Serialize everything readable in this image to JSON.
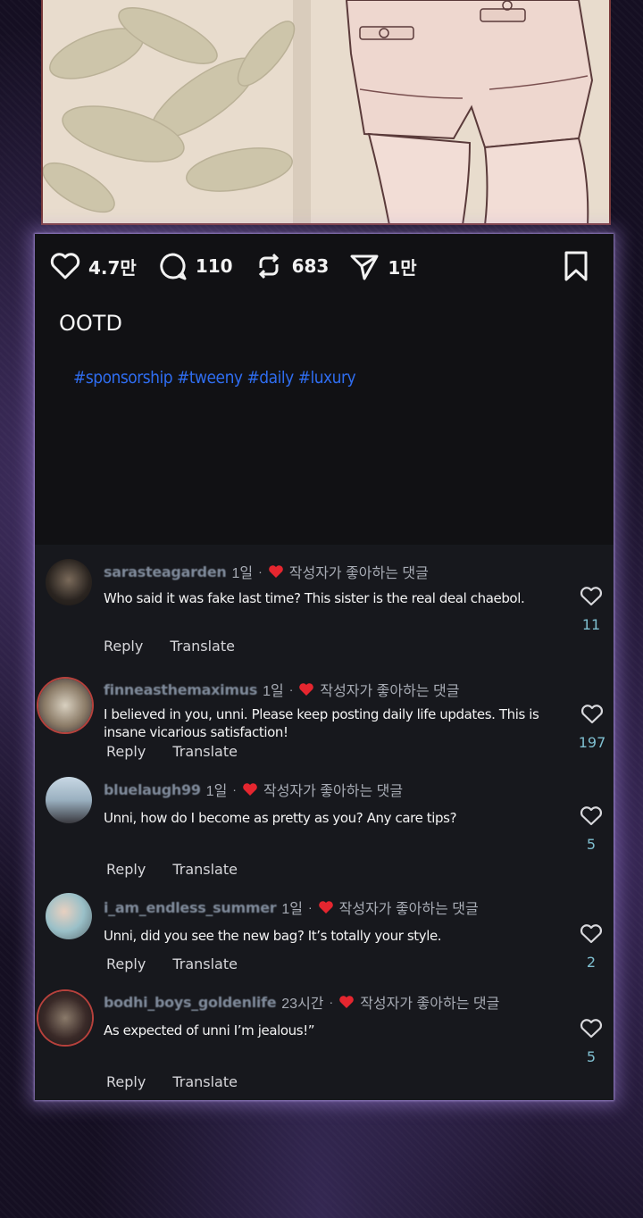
{
  "actions": {
    "likes": "4.7만",
    "comments": "110",
    "reposts": "683",
    "shares": "1만"
  },
  "post": {
    "caption": "OOTD",
    "hashtags": "#sponsorship #tweeny #daily #luxury"
  },
  "comment_labels": {
    "reply": "Reply",
    "translate": "Translate",
    "liked_by_author": "작성자가 좋아하는 댓글",
    "separator": "·"
  },
  "comments": [
    {
      "user": "sarasteagarden",
      "time": "1일",
      "text": "Who said it was fake last time? This sister is the real deal chaebol.",
      "likes": "11"
    },
    {
      "user": "finneasthemaximus",
      "time": "1일",
      "text": "I believed in you, unni. Please keep posting daily life updates. This is insane vicarious satisfaction!",
      "likes": "197"
    },
    {
      "user": "bluelaugh99",
      "time": "1일",
      "text": "Unni, how do I become as pretty as you? Any care tips?",
      "likes": "5"
    },
    {
      "user": "i_am_endless_summer",
      "time": "1일",
      "text": "Unni, did you see the new bag? It’s totally your style.",
      "likes": "2"
    },
    {
      "user": "bodhi_boys_goldenlife",
      "time": "23시간",
      "text": "As expected of unni  I’m jealous!”",
      "likes": "5"
    }
  ],
  "colors": {
    "panel_bg": "#111114",
    "comments_bg": "#17181d",
    "hashtag": "#2f6df0",
    "liked_heart": "#e5262f",
    "glow": "#b39ae8"
  },
  "icons": [
    "heart-outline-icon",
    "comment-bubble-icon",
    "repost-icon",
    "send-icon",
    "bookmark-icon",
    "heart-filled-icon"
  ]
}
